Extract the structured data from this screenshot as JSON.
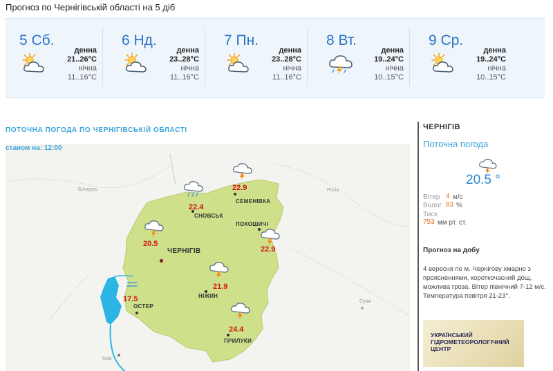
{
  "page": {
    "title": "Прогноз по Чернігівській області на 5 діб"
  },
  "forecast": {
    "day_label": "денна",
    "night_label": "нічна",
    "days": [
      {
        "title": "5 Сб.",
        "day_temp": "21..26°C",
        "night_temp": "11..16°C",
        "icon": "partly-cloudy-icon"
      },
      {
        "title": "6 Нд.",
        "day_temp": "23..28°C",
        "night_temp": "11..16°C",
        "icon": "partly-cloudy-icon"
      },
      {
        "title": "7 Пн.",
        "day_temp": "23..28°C",
        "night_temp": "11..16°C",
        "icon": "partly-cloudy-icon"
      },
      {
        "title": "8 Вт.",
        "day_temp": "19..24°C",
        "night_temp": "10..15°C",
        "icon": "thunderstorm-icon"
      },
      {
        "title": "9 Ср.",
        "day_temp": "19..24°C",
        "night_temp": "10..15°C",
        "icon": "partly-cloudy-icon"
      }
    ]
  },
  "current_map": {
    "title": "ПОТОЧНА ПОГОДА ПО ЧЕРНІГІВСЬКІЙ ОБЛАСТІ",
    "as_of": "станом на: 12:00",
    "cities": {
      "chernihiv": "ЧЕРНІГІВ",
      "snovsk": "СНОВСЬК",
      "semenivka": "СЕМЕНІВКА",
      "pokoshychi": "ПОКОШИЧІ",
      "oster": "ОСТЕР",
      "nizhyn": "НІЖИН",
      "pryluky": "ПРИЛУКИ"
    },
    "foreign": {
      "belarus": "Білорусь",
      "russia": "Росія",
      "sumy": "Суми",
      "kyiv": "Київ"
    },
    "temps": {
      "snovsk": "22.4",
      "semenivka": "22.9",
      "chernihiv": "20.5",
      "pokoshychi": "22.9",
      "nizhyn": "21.9",
      "oster": "17.5",
      "pryluky": "24.4"
    },
    "colors": {
      "region": "#cfe08a",
      "water": "#2bb5e5"
    }
  },
  "sidebar": {
    "city": "ЧЕРНІГІВ",
    "current_label": "Поточна погода",
    "current_temp": "20.5 °",
    "current_icon": "thunderstorm-icon",
    "wind_label": "Вітер",
    "wind_value": "4",
    "wind_unit": "м/с",
    "humidity_label": "Волог.",
    "humidity_value": "83",
    "humidity_unit": "%",
    "pressure_label": "Тиск",
    "pressure_value": "753",
    "pressure_unit": "мм рт. ст.",
    "daily_title": "Прогноз на добу",
    "daily_text": "4 вересня по м. Чернігову хмарно з проясненнями, короткочасний дощ, можлива гроза. Вітер північний 7-12 м/с. Температура повітря 21-23°.",
    "logo_text": "УКРАЇНСЬКИЙ ГІДРОМЕТЕОРОЛОГІЧНИЙ ЦЕНТР"
  }
}
